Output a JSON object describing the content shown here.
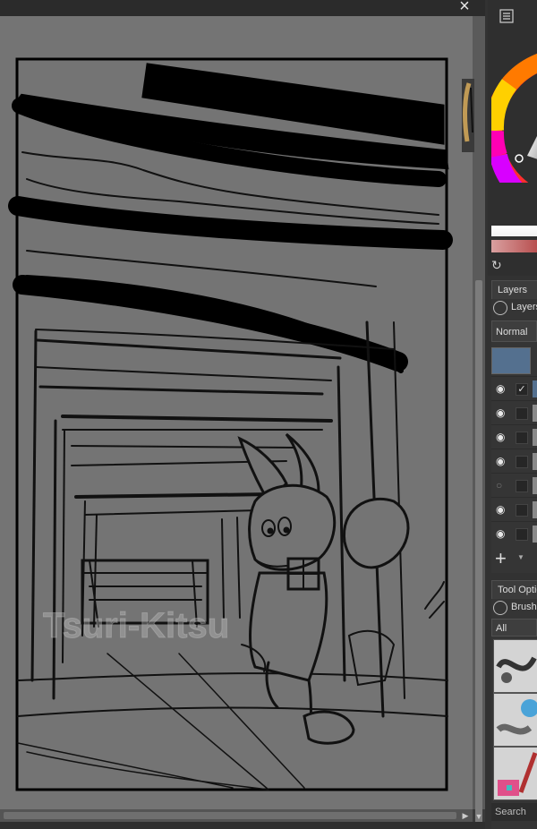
{
  "window": {
    "close_glyph": "×"
  },
  "canvas": {
    "watermark": "Tsuri-Kitsu",
    "background": "#747474"
  },
  "dock": {
    "layers_tab": "Layers",
    "layers_lock_label": "Layers",
    "blend_mode": "Normal",
    "layer_rows": [
      {
        "visible": true,
        "checked": true
      },
      {
        "visible": true,
        "checked": false
      },
      {
        "visible": true,
        "checked": false
      },
      {
        "visible": true,
        "checked": false
      },
      {
        "visible": false,
        "checked": false
      },
      {
        "visible": true,
        "checked": false
      },
      {
        "visible": true,
        "checked": false
      }
    ],
    "add_layer_glyph": "+",
    "tool_options_tab": "Tool Options",
    "brush_lock_label": "Brush Presets",
    "brush_filter": "All",
    "brush_search_placeholder": "Search",
    "icons": [
      "settings-icon",
      "refresh-icon",
      "lock-icon",
      "eye-icon",
      "add-icon"
    ],
    "accent_colors": {
      "active_layer": "#54708f",
      "canvas": "#747474"
    }
  }
}
